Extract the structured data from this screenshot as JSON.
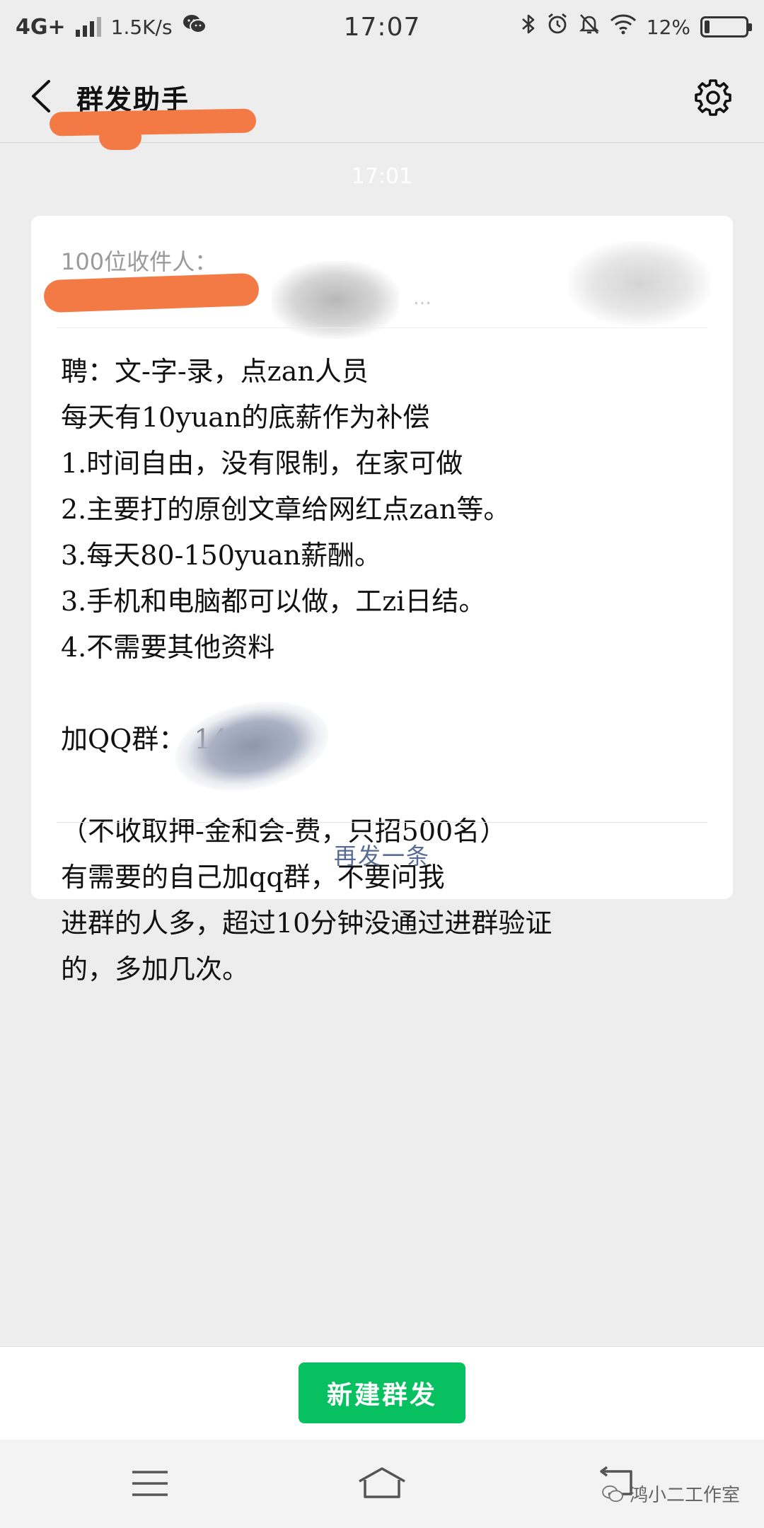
{
  "status_bar": {
    "network": "4G+",
    "speed": "1.5K/s",
    "time": "17:07",
    "battery_pct_label": "12%",
    "battery_level": 0.12,
    "icons": [
      "wechat-icon",
      "bluetooth-icon",
      "alarm-icon",
      "mute-bell-icon",
      "wifi-icon",
      "battery-icon"
    ]
  },
  "header": {
    "title": "群发助手",
    "icons": [
      "back-arrow-icon",
      "gear-icon"
    ]
  },
  "chat": {
    "timestamp": "17:01"
  },
  "message": {
    "recipients_label": "100位收件人：",
    "recipients_tail": "…",
    "lines": [
      "聘：文-字-录，点zan人员",
      "每天有10yuan的底薪作为补偿",
      "1.时间自由，没有限制，在家可做",
      "2.主要打的原创文章给网红点zan等。",
      "3.每天80-150yuan薪酬。",
      "3.手机和电脑都可以做，工zi日结。",
      "4.不需要其他资料",
      "",
      "加QQ群：        14咨询",
      "",
      "（不收取押-金和会-费，只招500名）",
      "有需要的自己加qq群，不要问我",
      "进群的人多，超过10分钟没通过进群验证",
      "的，多加几次。"
    ],
    "resend_label": "再发一条"
  },
  "footer": {
    "new_broadcast_label": "新建群发"
  },
  "nav_bar": {
    "icons": [
      "menu-icon",
      "home-icon",
      "back-icon"
    ],
    "watermark": "鸿小二工作室"
  },
  "colors": {
    "background": "#ededed",
    "accent_green": "#07c160",
    "link_blue": "#576b95",
    "redaction_orange": "#f47a45"
  }
}
